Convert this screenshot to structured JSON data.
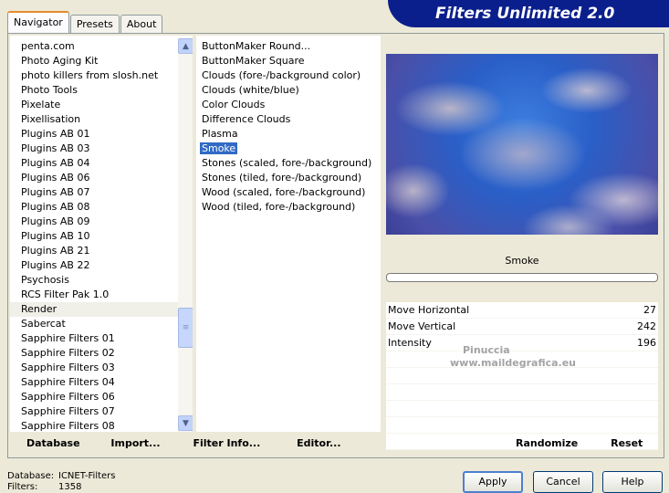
{
  "window": {
    "title": "Filters Unlimited 2.0"
  },
  "tabs": [
    "Navigator",
    "Presets",
    "About"
  ],
  "categories": [
    "penta.com",
    "Photo Aging Kit",
    "photo killers from slosh.net",
    "Photo Tools",
    "Pixelate",
    "Pixellisation",
    "Plugins AB 01",
    "Plugins AB 03",
    "Plugins AB 04",
    "Plugins AB 06",
    "Plugins AB 07",
    "Plugins AB 08",
    "Plugins AB 09",
    "Plugins AB 10",
    "Plugins AB 21",
    "Plugins AB 22",
    "Psychosis",
    "RCS Filter Pak 1.0",
    "Render",
    "Sabercat",
    "Sapphire Filters 01",
    "Sapphire Filters 02",
    "Sapphire Filters 03",
    "Sapphire Filters 04",
    "Sapphire Filters 06",
    "Sapphire Filters 07",
    "Sapphire Filters 08"
  ],
  "selected_category": "Render",
  "filters": [
    "ButtonMaker Round...",
    "ButtonMaker Square",
    "Clouds (fore-/background color)",
    "Clouds (white/blue)",
    "Color Clouds",
    "Difference Clouds",
    "Plasma",
    "Smoke",
    "Stones (scaled, fore-/background)",
    "Stones (tiled, fore-/background)",
    "Wood (scaled, fore-/background)",
    "Wood (tiled, fore-/background)"
  ],
  "selected_filter": "Smoke",
  "preview_filter_name": "Smoke",
  "params": [
    {
      "label": "Move Horizontal",
      "value": "27"
    },
    {
      "label": "Move Vertical",
      "value": "242"
    },
    {
      "label": "Intensity",
      "value": "196"
    }
  ],
  "watermark": {
    "line1": "Pinuccia",
    "line2": "www.maildegrafica.eu"
  },
  "bottom_buttons": {
    "database": "Database",
    "import": "Import...",
    "filter_info": "Filter Info...",
    "editor": "Editor...",
    "randomize": "Randomize",
    "reset": "Reset"
  },
  "status": {
    "database_label": "Database:",
    "database_value": "ICNET-Filters",
    "filters_label": "Filters:",
    "filters_value": "1358"
  },
  "dialog_buttons": {
    "apply": "Apply",
    "cancel": "Cancel",
    "help": "Help"
  },
  "icons": {
    "scroll_up": "chevron-up-icon",
    "scroll_down": "chevron-down-icon"
  }
}
